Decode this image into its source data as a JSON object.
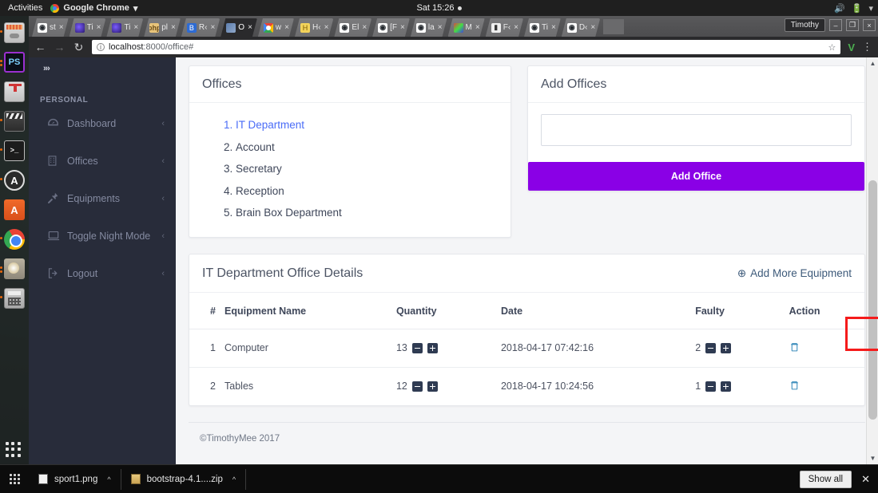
{
  "os": {
    "activities": "Activities",
    "active_app": "Google Chrome",
    "app_caret": "▾",
    "clock": "Sat 15:26",
    "tray": {
      "volume": "🔊",
      "battery": "🔋",
      "caret": "▾"
    },
    "dock_items": [
      {
        "name": "files-icon",
        "label": "Files"
      },
      {
        "name": "photoshop-icon",
        "label": "PS"
      },
      {
        "name": "downloads-icon",
        "label": "Downloads"
      },
      {
        "name": "video-editor-icon",
        "label": "Video Editor"
      },
      {
        "name": "terminal-icon",
        "label": ">_"
      },
      {
        "name": "atom-icon",
        "label": "A"
      },
      {
        "name": "ubuntu-software-icon",
        "label": "A"
      },
      {
        "name": "google-chrome-icon",
        "label": "Chrome"
      },
      {
        "name": "gimp-icon",
        "label": "GIMP"
      },
      {
        "name": "calculator-icon",
        "label": "Calculator"
      }
    ]
  },
  "browser": {
    "tabs": [
      {
        "label": "st",
        "favicon": "github-icon",
        "active": false
      },
      {
        "label": "Ti",
        "favicon": "timothy-icon",
        "active": false
      },
      {
        "label": "Ti",
        "favicon": "timothy-icon",
        "active": false
      },
      {
        "label": "pl",
        "favicon": "php-icon",
        "active": false
      },
      {
        "label": "R‹",
        "favicon": "bootstrap-icon",
        "active": false
      },
      {
        "label": "O",
        "favicon": "office-icon",
        "active": true
      },
      {
        "label": "w",
        "favicon": "google-icon",
        "active": false
      },
      {
        "label": "H‹",
        "favicon": "honey-icon",
        "active": false
      },
      {
        "label": "El",
        "favicon": "github-icon",
        "active": false
      },
      {
        "label": "[F",
        "favicon": "github-icon",
        "active": false
      },
      {
        "label": "la",
        "favicon": "github-icon",
        "active": false
      },
      {
        "label": "M",
        "favicon": "mosaic-icon",
        "active": false
      },
      {
        "label": "F‹",
        "favicon": "facebook-icon",
        "active": false
      },
      {
        "label": "Ti",
        "favicon": "github-icon",
        "active": false
      },
      {
        "label": "D‹",
        "favicon": "github-icon",
        "active": false
      }
    ],
    "tab_close": "×",
    "profile_name": "Timothy",
    "window_controls": {
      "minimize": "–",
      "maximize": "❐",
      "close": "×"
    },
    "nav": {
      "back": "←",
      "forward": "→",
      "reload": "↻"
    },
    "url_host": "localhost",
    "url_path": ":8000/office#",
    "url_info_icon": "ⓘ",
    "bookmark_star": "☆",
    "extension_badge": "V",
    "menu_icon": "⋮"
  },
  "sidebar": {
    "toggle": "»›",
    "heading": "PERSONAL",
    "items": [
      {
        "label": "Dashboard",
        "icon": "dashboard-icon",
        "caret": "‹"
      },
      {
        "label": "Offices",
        "icon": "building-icon",
        "caret": "‹"
      },
      {
        "label": "Equipments",
        "icon": "plug-icon",
        "caret": "‹"
      },
      {
        "label": "Toggle Night Mode",
        "icon": "laptop-icon",
        "caret": "‹"
      },
      {
        "label": "Logout",
        "icon": "logout-icon",
        "caret": "‹"
      }
    ]
  },
  "offices_card": {
    "title": "Offices",
    "items": [
      {
        "label": "IT Department",
        "active": true
      },
      {
        "label": "Account",
        "active": false
      },
      {
        "label": "Secretary",
        "active": false
      },
      {
        "label": "Reception",
        "active": false
      },
      {
        "label": "Brain Box Department",
        "active": false
      }
    ]
  },
  "add_offices_card": {
    "title": "Add Offices",
    "textarea_value": "",
    "textarea_placeholder": "",
    "button_label": "Add Office",
    "button_color": "#8a00e6"
  },
  "details_card": {
    "title": "IT Department Office Details",
    "add_link_label": "Add More Equipment",
    "add_link_icon": "⊕",
    "columns": [
      "#",
      "Equipment Name",
      "Quantity",
      "Date",
      "Faulty",
      "Action"
    ],
    "rows": [
      {
        "num": "1",
        "name": "Computer",
        "quantity": "13",
        "date": "2018-04-17 07:42:16",
        "faulty": "2",
        "action_icon": "trash-icon",
        "faulty_highlighted": true
      },
      {
        "num": "2",
        "name": "Tables",
        "quantity": "12",
        "date": "2018-04-17 10:24:56",
        "faulty": "1",
        "action_icon": "trash-icon",
        "faulty_highlighted": false
      }
    ],
    "stepper": {
      "minus": "−",
      "plus": "+"
    },
    "highlight_color": "#f51b1b"
  },
  "footer": {
    "copyright": "©TimothyMee 2017"
  },
  "scrollbar": {
    "up": "▲",
    "down": "▼"
  },
  "download_shelf": {
    "items": [
      {
        "filename": "sport1.png",
        "type": "png",
        "caret": "^"
      },
      {
        "filename": "bootstrap-4.1....zip",
        "type": "zip",
        "caret": "^"
      }
    ],
    "show_all_label": "Show all",
    "close_label": "✕"
  }
}
